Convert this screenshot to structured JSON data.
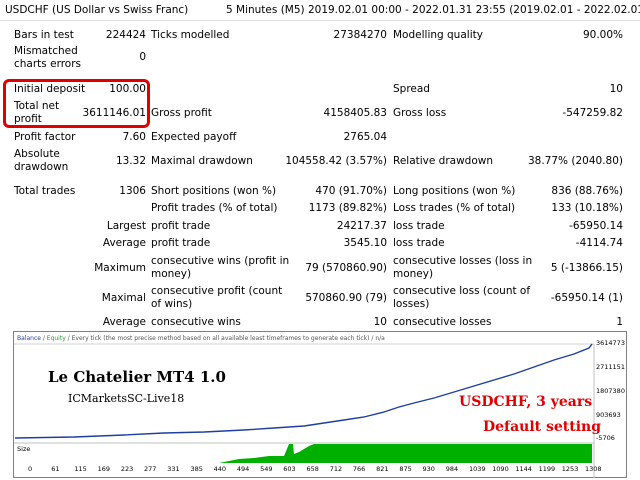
{
  "header": {
    "symbol": "USDCHF (US Dollar vs Swiss Franc)",
    "period": "5 Minutes (M5) 2019.02.01 00:00 - 2022.01.31 23:55 (2019.02.01 - 2022.02.01)"
  },
  "rows": {
    "bars_label": "Bars in test",
    "bars_value": "224424",
    "ticks_label": "Ticks modelled",
    "ticks_value": "27384270",
    "quality_label": "Modelling quality",
    "quality_value": "90.00%",
    "mismatch_label": "Mismatched charts errors",
    "mismatch_value": "0",
    "deposit_label": "Initial deposit",
    "deposit_value": "100.00",
    "spread_label": "Spread",
    "spread_value": "10",
    "netprofit_label": "Total net profit",
    "netprofit_value": "3611146.01",
    "grossprofit_label": "Gross profit",
    "grossprofit_value": "4158405.83",
    "grossloss_label": "Gross loss",
    "grossloss_value": "-547259.82",
    "pf_label": "Profit factor",
    "pf_value": "7.60",
    "payoff_label": "Expected payoff",
    "payoff_value": "2765.04",
    "absdd_label": "Absolute drawdown",
    "absdd_value": "13.32",
    "maxdd_label": "Maximal drawdown",
    "maxdd_value": "104558.42 (3.57%)",
    "reldd_label": "Relative drawdown",
    "reldd_value": "38.77% (2040.80)",
    "trades_label": "Total trades",
    "trades_value": "1306",
    "short_label": "Short positions (won %)",
    "short_value": "470 (91.70%)",
    "long_label": "Long positions (won %)",
    "long_value": "836 (88.76%)",
    "ptrades_label": "Profit trades (% of total)",
    "ptrades_value": "1173 (89.82%)",
    "ltrades_label": "Loss trades (% of total)",
    "ltrades_value": "133 (10.18%)",
    "largest_label": "Largest",
    "largest_profit_label": "profit trade",
    "largest_profit_value": "24217.37",
    "largest_loss_label": "loss trade",
    "largest_loss_value": "-65950.14",
    "average_label": "Average",
    "average_profit_label": "profit trade",
    "average_profit_value": "3545.10",
    "average_loss_label": "loss trade",
    "average_loss_value": "-4114.74",
    "maximum_label": "Maximum",
    "maxwins_label": "consecutive wins (profit in money)",
    "maxwins_value": "79 (570860.90)",
    "maxlosses_label": "consecutive losses (loss in money)",
    "maxlosses_value": "5 (-13866.15)",
    "maximal_label": "Maximal",
    "maxprofit_label": "consecutive profit (count of wins)",
    "maxprofit_value": "570860.90 (79)",
    "maxloss_label": "consecutive loss (count of losses)",
    "maxloss_value": "-65950.14 (1)",
    "average2_label": "Average",
    "avgwins_label": "consecutive wins",
    "avgwins_value": "10",
    "avglosses_label": "consecutive losses",
    "avglosses_value": "1"
  },
  "chart": {
    "legend_balance": "Balance",
    "legend_sep": " / ",
    "legend_equity": "Equity",
    "legend_rest": " / Every tick (the most precise method based on all available least timeframes to generate each tick) / n/a",
    "y_ticks": [
      "3614773",
      "2711151",
      "1807380",
      "903693",
      "-5706"
    ],
    "size_label": "Size",
    "x_ticks": [
      "0",
      "61",
      "115",
      "169",
      "223",
      "277",
      "331",
      "385",
      "440",
      "494",
      "549",
      "603",
      "658",
      "712",
      "766",
      "821",
      "875",
      "930",
      "984",
      "1039",
      "1090",
      "1144",
      "1199",
      "1253",
      "1308"
    ],
    "balance_color": "#1f3fa0",
    "size_color": "#00b000"
  },
  "overlays": {
    "ea_name": "Le Chatelier MT4 1.0",
    "account": "ICMarketsSC-Live18",
    "pair_years": "USDCHF,  3 years",
    "setting": "Default setting"
  }
}
